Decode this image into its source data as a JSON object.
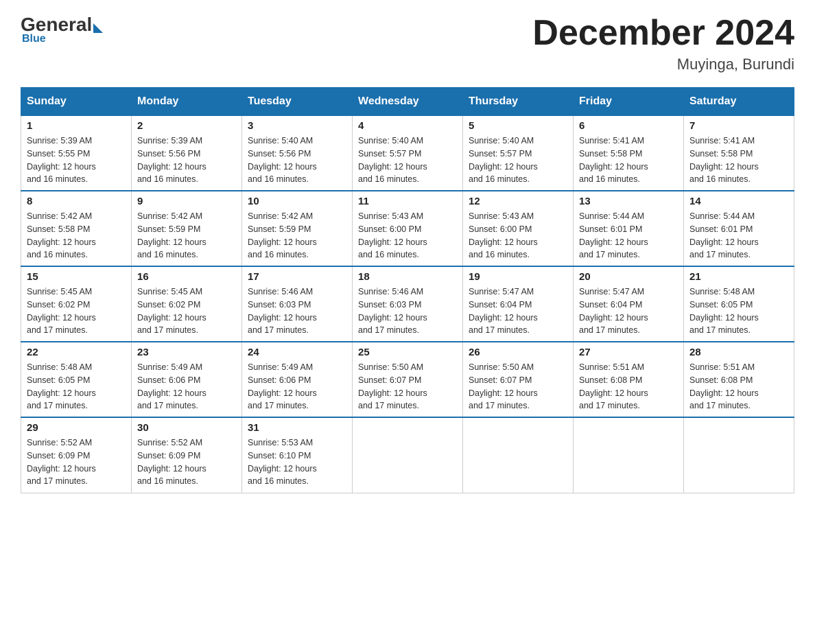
{
  "header": {
    "title": "December 2024",
    "location": "Muyinga, Burundi",
    "logo_general": "General",
    "logo_blue": "Blue"
  },
  "days_of_week": [
    "Sunday",
    "Monday",
    "Tuesday",
    "Wednesday",
    "Thursday",
    "Friday",
    "Saturday"
  ],
  "weeks": [
    [
      {
        "day": "1",
        "sunrise": "5:39 AM",
        "sunset": "5:55 PM",
        "daylight": "12 hours and 16 minutes."
      },
      {
        "day": "2",
        "sunrise": "5:39 AM",
        "sunset": "5:56 PM",
        "daylight": "12 hours and 16 minutes."
      },
      {
        "day": "3",
        "sunrise": "5:40 AM",
        "sunset": "5:56 PM",
        "daylight": "12 hours and 16 minutes."
      },
      {
        "day": "4",
        "sunrise": "5:40 AM",
        "sunset": "5:57 PM",
        "daylight": "12 hours and 16 minutes."
      },
      {
        "day": "5",
        "sunrise": "5:40 AM",
        "sunset": "5:57 PM",
        "daylight": "12 hours and 16 minutes."
      },
      {
        "day": "6",
        "sunrise": "5:41 AM",
        "sunset": "5:58 PM",
        "daylight": "12 hours and 16 minutes."
      },
      {
        "day": "7",
        "sunrise": "5:41 AM",
        "sunset": "5:58 PM",
        "daylight": "12 hours and 16 minutes."
      }
    ],
    [
      {
        "day": "8",
        "sunrise": "5:42 AM",
        "sunset": "5:58 PM",
        "daylight": "12 hours and 16 minutes."
      },
      {
        "day": "9",
        "sunrise": "5:42 AM",
        "sunset": "5:59 PM",
        "daylight": "12 hours and 16 minutes."
      },
      {
        "day": "10",
        "sunrise": "5:42 AM",
        "sunset": "5:59 PM",
        "daylight": "12 hours and 16 minutes."
      },
      {
        "day": "11",
        "sunrise": "5:43 AM",
        "sunset": "6:00 PM",
        "daylight": "12 hours and 16 minutes."
      },
      {
        "day": "12",
        "sunrise": "5:43 AM",
        "sunset": "6:00 PM",
        "daylight": "12 hours and 16 minutes."
      },
      {
        "day": "13",
        "sunrise": "5:44 AM",
        "sunset": "6:01 PM",
        "daylight": "12 hours and 17 minutes."
      },
      {
        "day": "14",
        "sunrise": "5:44 AM",
        "sunset": "6:01 PM",
        "daylight": "12 hours and 17 minutes."
      }
    ],
    [
      {
        "day": "15",
        "sunrise": "5:45 AM",
        "sunset": "6:02 PM",
        "daylight": "12 hours and 17 minutes."
      },
      {
        "day": "16",
        "sunrise": "5:45 AM",
        "sunset": "6:02 PM",
        "daylight": "12 hours and 17 minutes."
      },
      {
        "day": "17",
        "sunrise": "5:46 AM",
        "sunset": "6:03 PM",
        "daylight": "12 hours and 17 minutes."
      },
      {
        "day": "18",
        "sunrise": "5:46 AM",
        "sunset": "6:03 PM",
        "daylight": "12 hours and 17 minutes."
      },
      {
        "day": "19",
        "sunrise": "5:47 AM",
        "sunset": "6:04 PM",
        "daylight": "12 hours and 17 minutes."
      },
      {
        "day": "20",
        "sunrise": "5:47 AM",
        "sunset": "6:04 PM",
        "daylight": "12 hours and 17 minutes."
      },
      {
        "day": "21",
        "sunrise": "5:48 AM",
        "sunset": "6:05 PM",
        "daylight": "12 hours and 17 minutes."
      }
    ],
    [
      {
        "day": "22",
        "sunrise": "5:48 AM",
        "sunset": "6:05 PM",
        "daylight": "12 hours and 17 minutes."
      },
      {
        "day": "23",
        "sunrise": "5:49 AM",
        "sunset": "6:06 PM",
        "daylight": "12 hours and 17 minutes."
      },
      {
        "day": "24",
        "sunrise": "5:49 AM",
        "sunset": "6:06 PM",
        "daylight": "12 hours and 17 minutes."
      },
      {
        "day": "25",
        "sunrise": "5:50 AM",
        "sunset": "6:07 PM",
        "daylight": "12 hours and 17 minutes."
      },
      {
        "day": "26",
        "sunrise": "5:50 AM",
        "sunset": "6:07 PM",
        "daylight": "12 hours and 17 minutes."
      },
      {
        "day": "27",
        "sunrise": "5:51 AM",
        "sunset": "6:08 PM",
        "daylight": "12 hours and 17 minutes."
      },
      {
        "day": "28",
        "sunrise": "5:51 AM",
        "sunset": "6:08 PM",
        "daylight": "12 hours and 17 minutes."
      }
    ],
    [
      {
        "day": "29",
        "sunrise": "5:52 AM",
        "sunset": "6:09 PM",
        "daylight": "12 hours and 17 minutes."
      },
      {
        "day": "30",
        "sunrise": "5:52 AM",
        "sunset": "6:09 PM",
        "daylight": "12 hours and 16 minutes."
      },
      {
        "day": "31",
        "sunrise": "5:53 AM",
        "sunset": "6:10 PM",
        "daylight": "12 hours and 16 minutes."
      },
      null,
      null,
      null,
      null
    ]
  ],
  "labels": {
    "sunrise": "Sunrise:",
    "sunset": "Sunset:",
    "daylight": "Daylight:"
  }
}
